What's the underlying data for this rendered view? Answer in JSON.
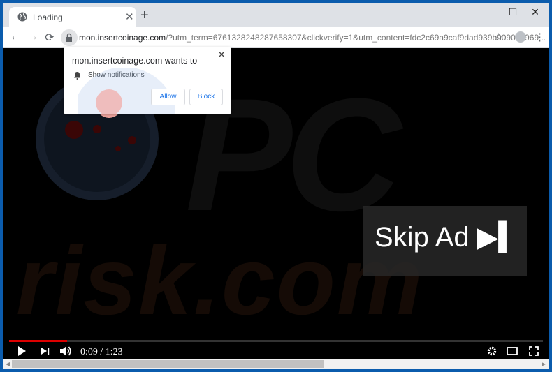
{
  "browser": {
    "tab_title": "Loading",
    "url_host": "mon.insertcoinage.com",
    "url_rest": "/?utm_term=6761328248287658307&clickverify=1&utm_content=fdc2c69a9caf9dad939b9090a6969...",
    "window_controls": {
      "minimize": "—",
      "maximize": "☐",
      "close": "✕"
    },
    "icons": {
      "back": "←",
      "forward": "→",
      "reload": "⟳",
      "star": "☆",
      "menu": "⋮",
      "new_tab": "+",
      "tab_close": "✕"
    }
  },
  "notification_popup": {
    "message": "mon.insertcoinage.com wants to",
    "permission": "Show notifications",
    "allow_label": "Allow",
    "block_label": "Block",
    "close": "✕"
  },
  "video": {
    "watermark_top": "PC",
    "watermark_bottom": "risk.com",
    "skip_label": "Skip Ad ▶▍",
    "time_display": "0:09 / 1:23",
    "progress_fraction": 0.108,
    "icons": {
      "play": "▶",
      "next": "▶|",
      "volume": "🔊",
      "settings": "⚙",
      "theater": "▭",
      "fullscreen": "⛶"
    },
    "progress_color": "#dd0000"
  },
  "scrollbar": {
    "thumb_fraction": 0.59,
    "left_arrow": "◀",
    "right_arrow": "▶"
  }
}
